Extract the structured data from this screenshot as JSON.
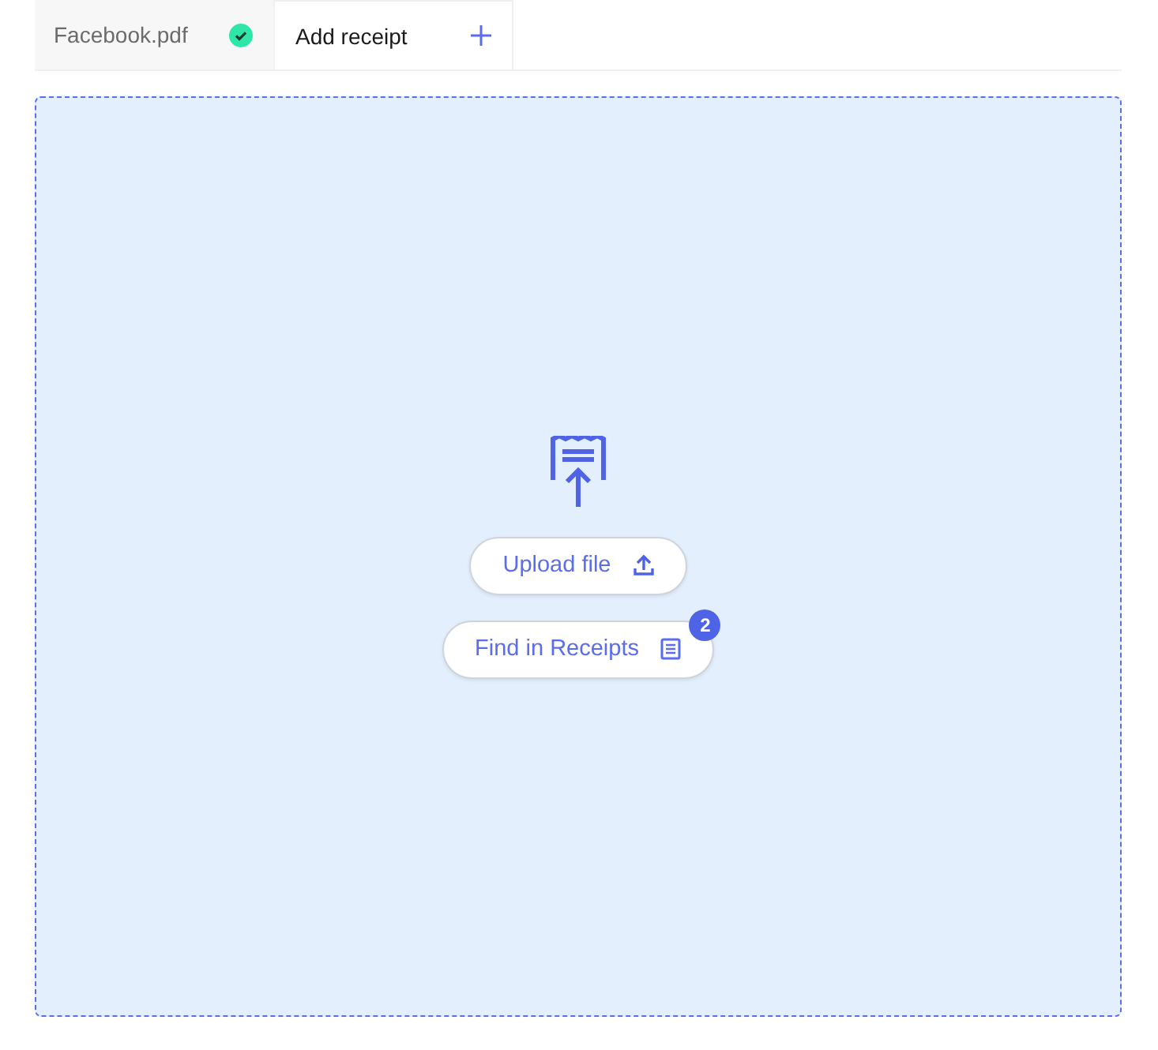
{
  "tabs": [
    {
      "label": "Facebook.pdf",
      "kind": "file",
      "selected": false,
      "completed": true
    },
    {
      "label": "Add receipt",
      "kind": "add",
      "selected": true
    }
  ],
  "dropzone": {
    "buttons": [
      {
        "label": "Upload file",
        "kind": "upload"
      },
      {
        "label": "Find in Receipts",
        "kind": "receipts",
        "badge": "2"
      }
    ]
  }
}
